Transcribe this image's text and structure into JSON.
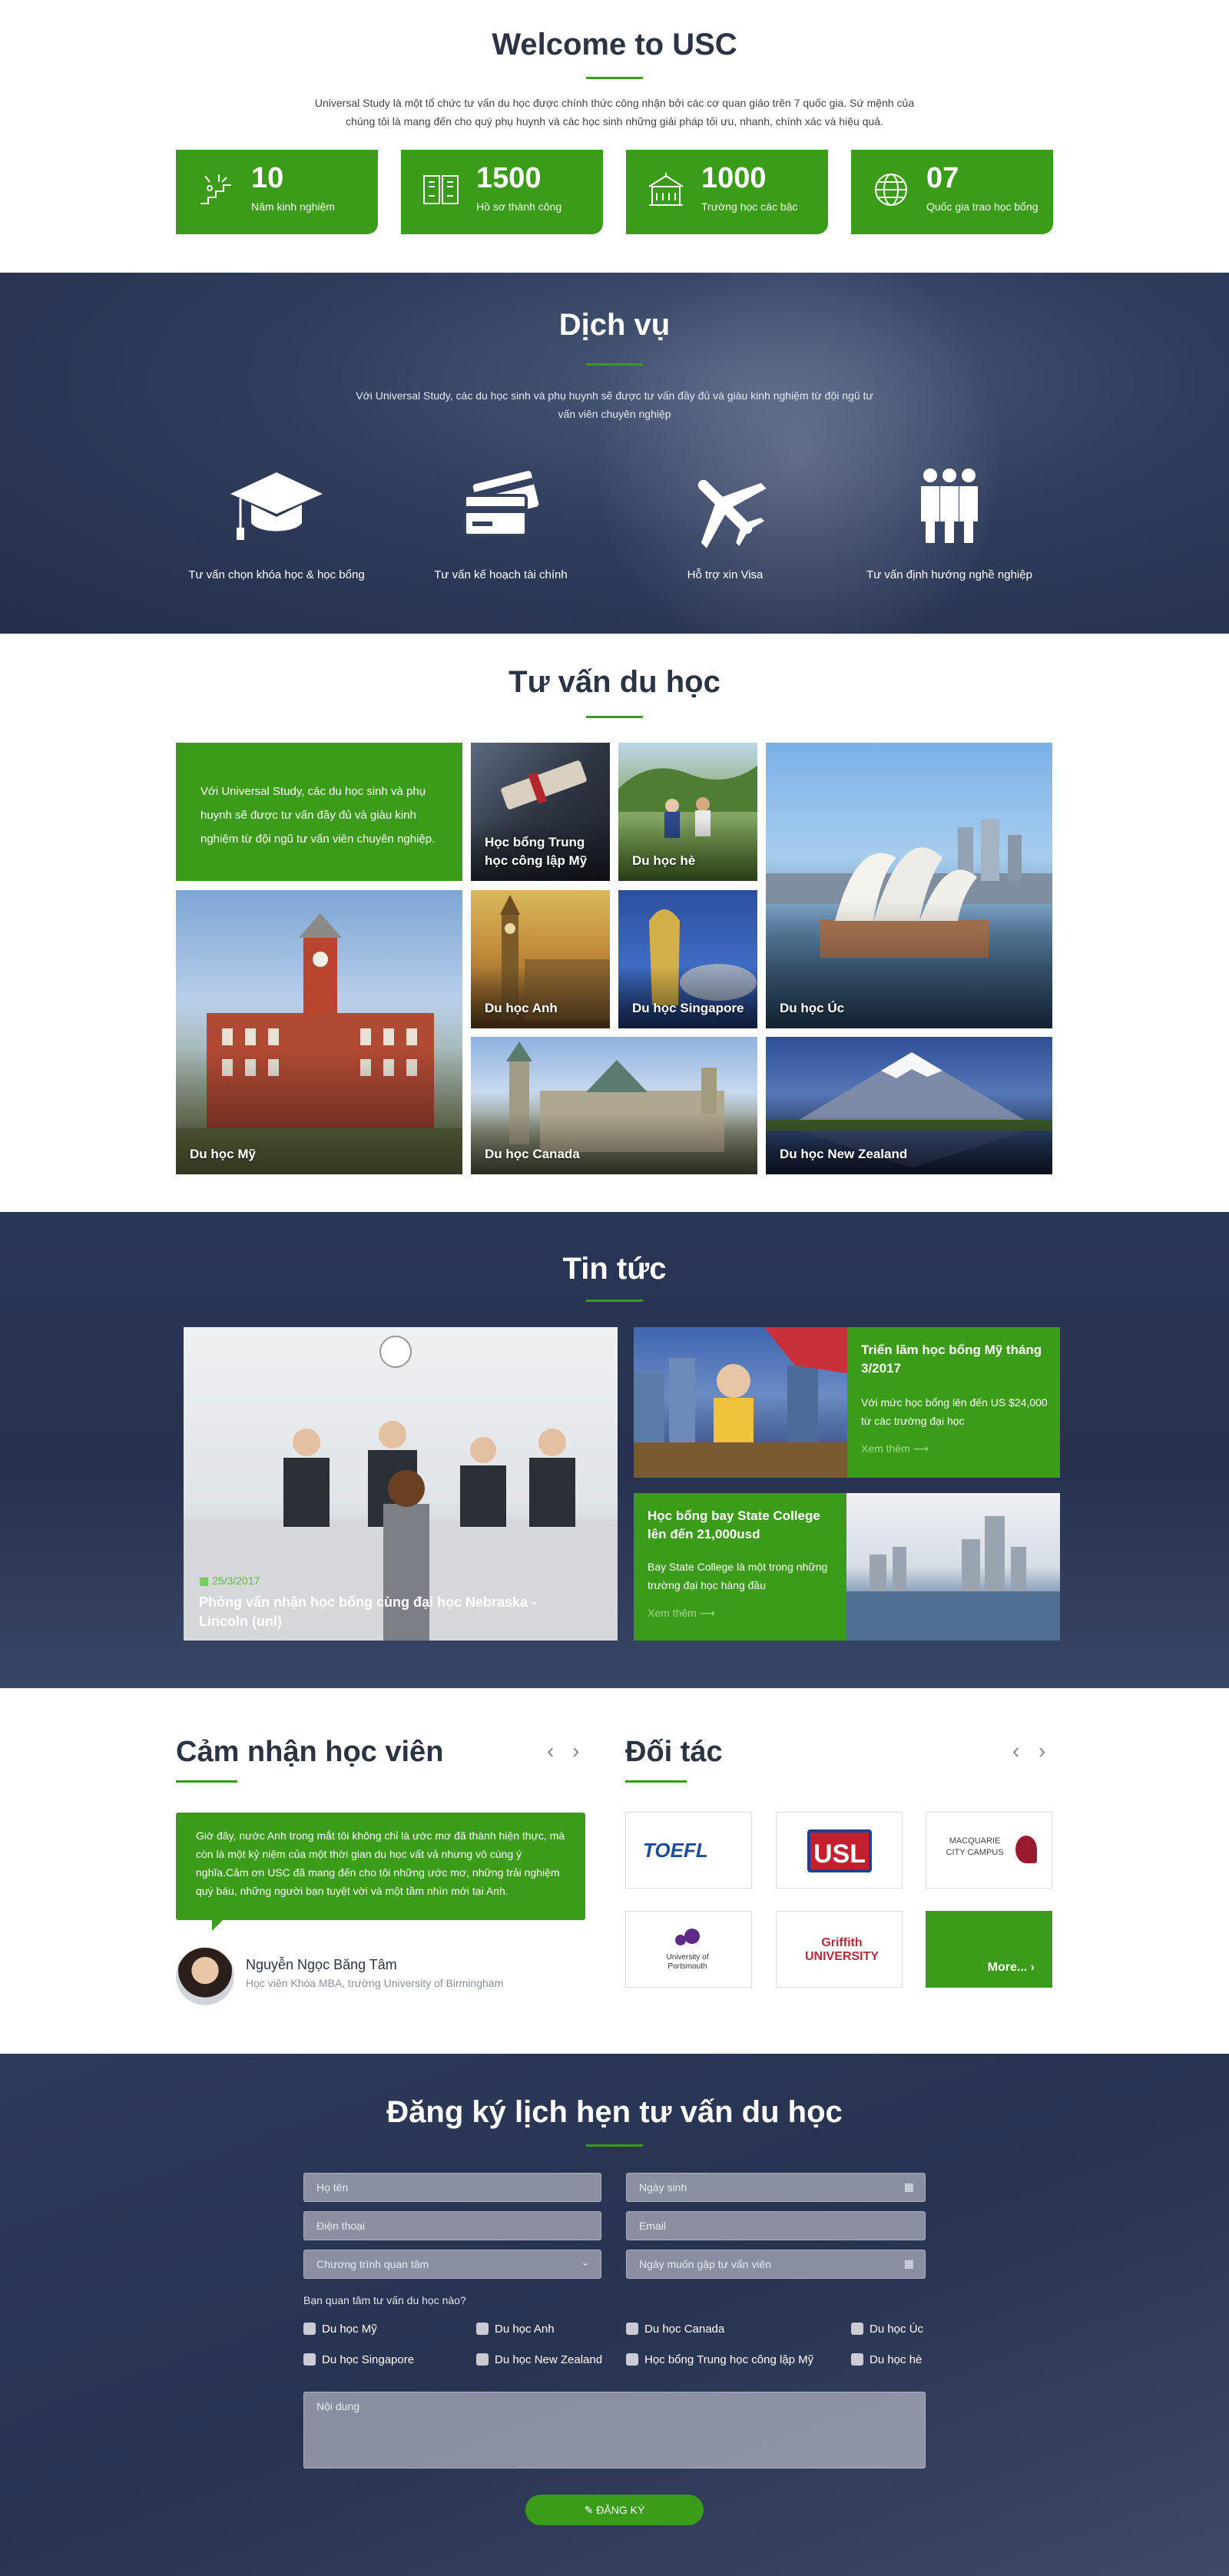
{
  "welcome": {
    "title": "Welcome to USC",
    "intro": "Universal Study là một tổ chức tư vấn du học được chính thức công nhận bởi các cơ quan giáo trên 7 quốc gia. Sứ mệnh của chúng tôi là mang đến cho quý phụ huynh và các học sinh những  giải pháp tối ưu, nhanh, chính xác và hiệu quả.",
    "stats": [
      {
        "value": "10",
        "label": "Năm kinh nghiệm",
        "icon": "steps-icon"
      },
      {
        "value": "1500",
        "label": "Hồ sơ thành công",
        "icon": "files-icon"
      },
      {
        "value": "1000",
        "label": "Trường học các bậc",
        "icon": "school-icon"
      },
      {
        "value": "07",
        "label": "Quốc gia trao học bổng",
        "icon": "globe-icon"
      }
    ]
  },
  "services": {
    "title": "Dịch vụ",
    "intro": "Với Universal Study, các du học sinh và phụ huynh sẽ được tư vấn đầy đủ và giàu kinh nghiệm từ đội ngũ tư vấn viên chuyên nghiệp",
    "items": [
      {
        "label": "Tư vấn chọn khóa học & học bổng",
        "icon": "graduation-cap-icon"
      },
      {
        "label": "Tư vấn kế hoạch tài chính",
        "icon": "credit-card-icon"
      },
      {
        "label": "Hỗ trợ xin Visa",
        "icon": "airplane-icon"
      },
      {
        "label": "Tư vấn định hướng nghề nghiệp",
        "icon": "people-icon"
      }
    ]
  },
  "consult": {
    "title": "Tư vấn du học",
    "intro": "Với Universal Study, các du học sinh và phụ huynh sẽ được tư vấn đầy đủ và giàu kinh nghiệm từ đội ngũ tư vấn viên chuyên nghiệp.",
    "tiles": [
      {
        "label": "Học bổng Trung học công lập Mỹ"
      },
      {
        "label": "Du học hè"
      },
      {
        "label": "Du học Úc"
      },
      {
        "label": "Du học Mỹ"
      },
      {
        "label": "Du học Anh"
      },
      {
        "label": "Du học Singapore"
      },
      {
        "label": "Du học Canada"
      },
      {
        "label": "Du học New Zealand"
      }
    ]
  },
  "news": {
    "title": "Tin tức",
    "featured": {
      "date": "25/3/2017",
      "title": "Phỏng vấn nhận học bổng cùng đại học Nebraska - Lincoln (unl)"
    },
    "items": [
      {
        "title": "Triển lãm học bổng Mỹ tháng 3/2017",
        "desc": "Với mức học bổng lên đến US $24,000 từ các trường đại học",
        "more": "Xem thêm ⟶"
      },
      {
        "title": "Học bổng bay State College lên đến 21,000usd",
        "desc": "Bay State College là một trong những trường đại học hàng đầu",
        "more": "Xem thêm ⟶"
      }
    ]
  },
  "testimonials": {
    "title": "Cảm nhận học viên",
    "quote": "Giờ đây, nước Anh trong mắt tôi không chỉ là ước mơ đã thành hiện thực, mà còn là một kỷ niệm của một thời gian du học vất vả nhưng vô cùng ý nghĩa.Cảm ơn USC đã mang đến cho tôi những ước mơ, những trải nghiệm quý báu, những người bạn tuyệt vời và một tầm nhìn mới tại Anh.",
    "name": "Nguyễn Ngọc Băng Tâm",
    "role": "Học viên Khóa MBA, trường University of Birmingham",
    "prev": "‹",
    "next": "›"
  },
  "partners": {
    "title": "Đối tác",
    "logos": [
      "TOEFL",
      "USL",
      "MACQUARIE CITY CAMPUS",
      "University of Portsmouth",
      "Griffith UNIVERSITY"
    ],
    "more": "More... ›",
    "prev": "‹",
    "next": "›"
  },
  "form": {
    "title": "Đăng ký lịch hẹn tư vấn du học",
    "fields": {
      "name": "Họ tên",
      "dob": "Ngày sinh",
      "phone": "Điện thoại",
      "email": "Email",
      "program": "Chương trình quan tâm",
      "meet": "Ngày muốn gặp tư vấn viên",
      "content": "Nội dung"
    },
    "question": "Bạn quan tâm tư vấn du học nào?",
    "options": [
      "Du học Mỹ",
      "Du học Anh",
      "Du học Canada",
      "Du học Úc",
      "Du học Singapore",
      "Du học New Zealand",
      "Học bổng Trung học công lập Mỹ",
      "Du học hè"
    ],
    "submit": "ĐĂNG KÝ"
  },
  "colors": {
    "accent": "#3b9c1a",
    "navy": "#2b3445"
  }
}
